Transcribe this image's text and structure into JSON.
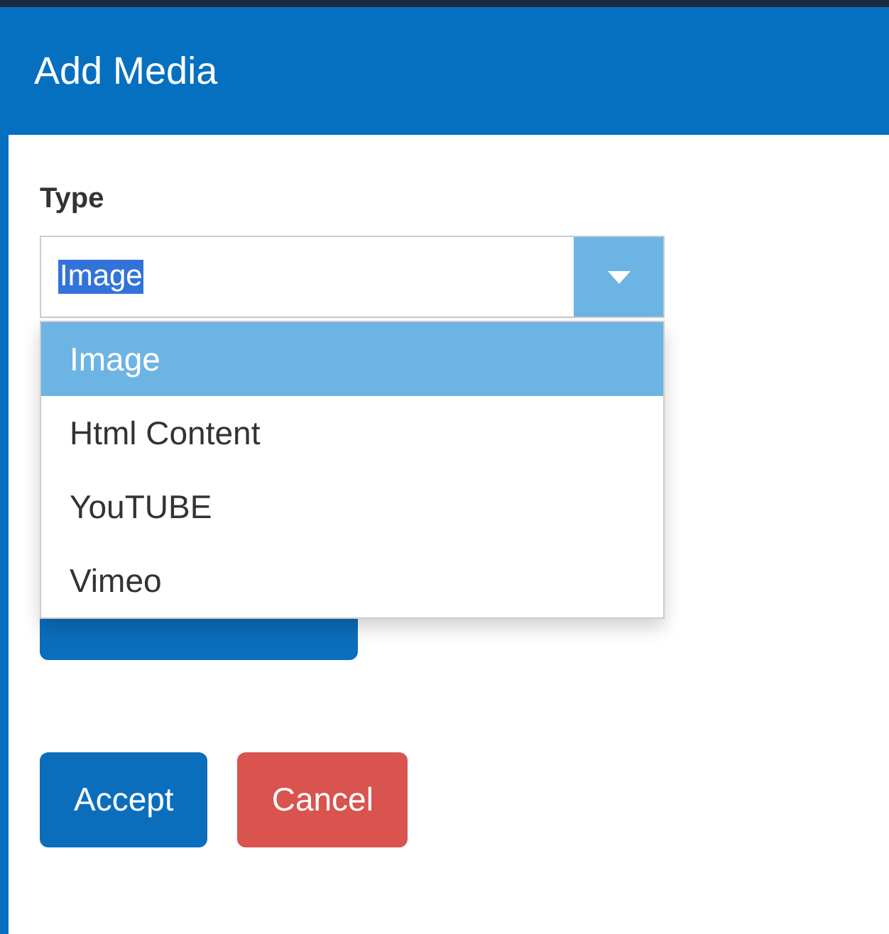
{
  "dialog": {
    "title": "Add Media"
  },
  "type_field": {
    "label": "Type",
    "value": "Image",
    "expanded": true,
    "options": [
      {
        "label": "Image",
        "selected": true
      },
      {
        "label": "Html Content",
        "selected": false
      },
      {
        "label": "YouTUBE",
        "selected": false
      },
      {
        "label": "Vimeo",
        "selected": false
      }
    ]
  },
  "buttons": [
    {
      "label": "Accept",
      "kind": "primary"
    },
    {
      "label": "Cancel",
      "kind": "danger"
    }
  ]
}
